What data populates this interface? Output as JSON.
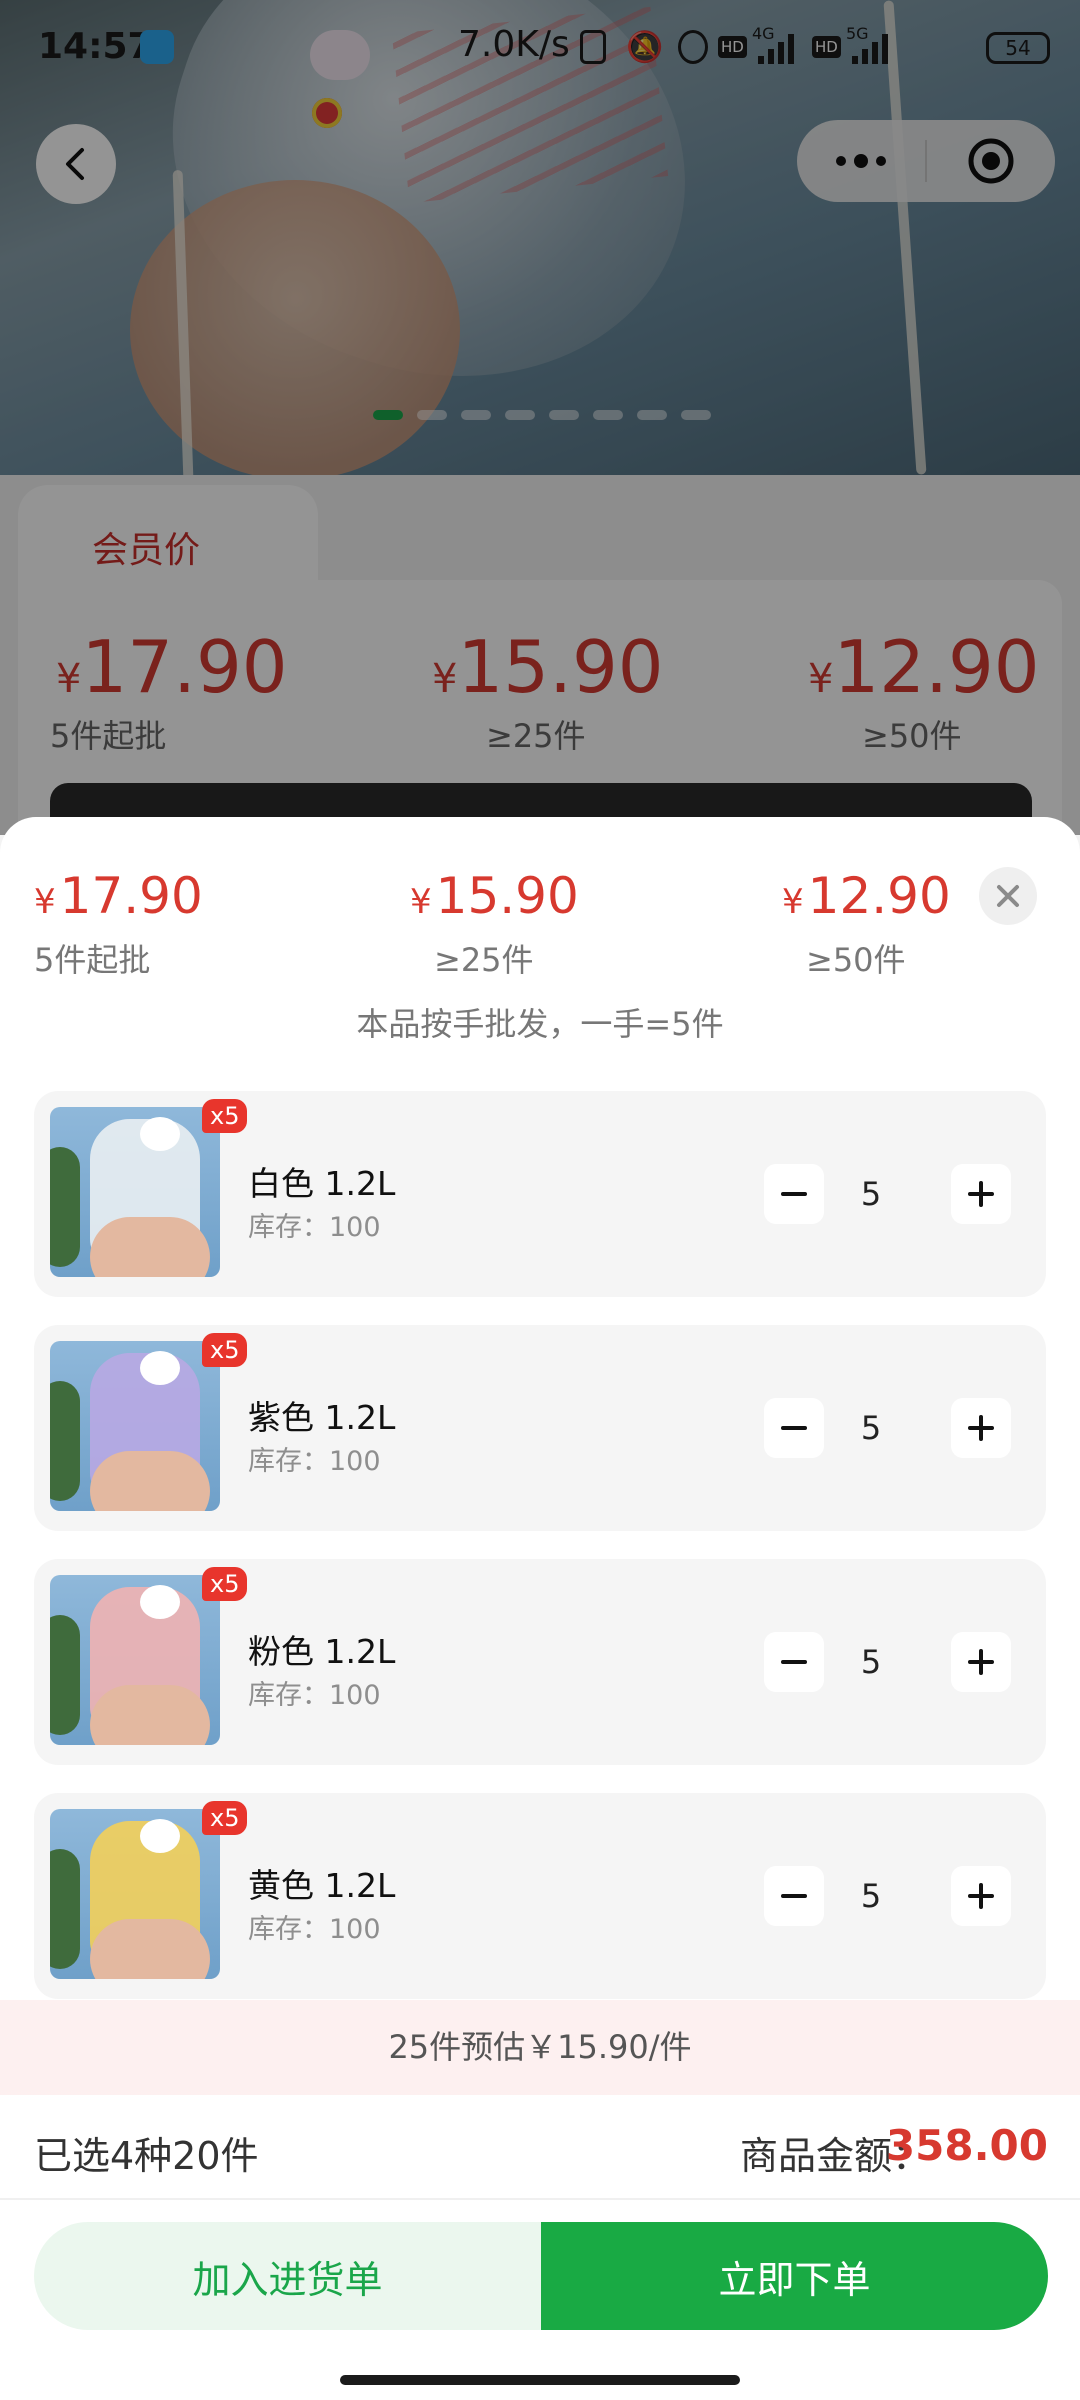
{
  "status_bar": {
    "time": "14:57",
    "network_speed": "7.0K/s",
    "battery": "54",
    "net_labels": [
      "4G",
      "HD",
      "5G",
      "HD"
    ]
  },
  "nav": {
    "back_icon": "chevron-left-icon",
    "more_icon": "more-dots-icon",
    "target_icon": "target-icon"
  },
  "carousel": {
    "count": 8,
    "active": 0,
    "accent": "#1aa64a"
  },
  "background_page": {
    "tab_label": "会员价",
    "tiers": [
      {
        "price": "17.90",
        "note": "5件起批"
      },
      {
        "price": "15.90",
        "note": "≥25件"
      },
      {
        "price": "12.90",
        "note": "≥50件"
      }
    ],
    "currency": "¥"
  },
  "sheet": {
    "currency": "¥",
    "tiers": [
      {
        "price": "17.90",
        "note": "5件起批"
      },
      {
        "price": "15.90",
        "note": "≥25件"
      },
      {
        "price": "12.90",
        "note": "≥50件"
      }
    ],
    "hand_note": "本品按手批发，一手=5件",
    "items": [
      {
        "name": "白色 1.2L",
        "stock": "库存：100",
        "qty": "5",
        "badge": "x5",
        "color": "#e9eef2"
      },
      {
        "name": "紫色 1.2L",
        "stock": "库存：100",
        "qty": "5",
        "badge": "x5",
        "color": "#b8a9e3"
      },
      {
        "name": "粉色 1.2L",
        "stock": "库存：100",
        "qty": "5",
        "badge": "x5",
        "color": "#f0b3b3"
      },
      {
        "name": "黄色 1.2L",
        "stock": "库存：100",
        "qty": "5",
        "badge": "x5",
        "color": "#f3cf5a"
      }
    ],
    "estimate": "25件预估￥15.90/件",
    "selected_summary": "已选4种20件",
    "amount_label": "商品金额：",
    "amount_value": "358.00",
    "add_to_cart": "加入进货单",
    "buy_now": "立即下单"
  },
  "colors": {
    "price_red": "#d7392f",
    "brand_green": "#19aa44"
  }
}
